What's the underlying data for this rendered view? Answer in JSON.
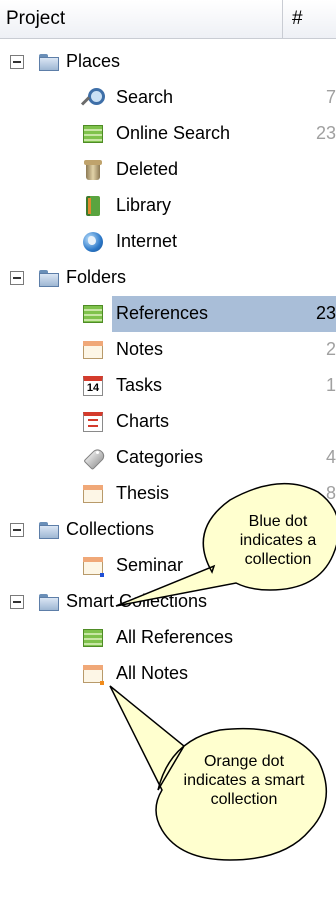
{
  "header": {
    "project_label": "Project",
    "count_label": "#"
  },
  "tree": {
    "places": {
      "label": "Places",
      "items": {
        "search": {
          "label": "Search",
          "count": "7"
        },
        "online_search": {
          "label": "Online Search",
          "count": "23"
        },
        "deleted": {
          "label": "Deleted",
          "count": ""
        },
        "library": {
          "label": "Library",
          "count": ""
        },
        "internet": {
          "label": "Internet",
          "count": ""
        }
      }
    },
    "folders": {
      "label": "Folders",
      "items": {
        "references": {
          "label": "References",
          "count": "23"
        },
        "notes": {
          "label": "Notes",
          "count": "2"
        },
        "tasks": {
          "label": "Tasks",
          "count": "1"
        },
        "charts": {
          "label": "Charts",
          "count": ""
        },
        "categories": {
          "label": "Categories",
          "count": "4"
        },
        "thesis": {
          "label": "Thesis",
          "count": "8"
        }
      }
    },
    "collections": {
      "label": "Collections",
      "items": {
        "seminar": {
          "label": "Seminar",
          "count": ""
        }
      }
    },
    "smart_collections": {
      "label": "Smart Collections",
      "items": {
        "all_references": {
          "label": "All References",
          "count": ""
        },
        "all_notes": {
          "label": "All Notes",
          "count": ""
        }
      }
    }
  },
  "callouts": {
    "blue": "Blue dot indicates a collection",
    "orange": "Orange dot indicates a smart collection"
  },
  "colors": {
    "selection": "#a9bed8",
    "collection_dot": "#1f4fd6",
    "smart_collection_dot": "#f08a1a"
  }
}
